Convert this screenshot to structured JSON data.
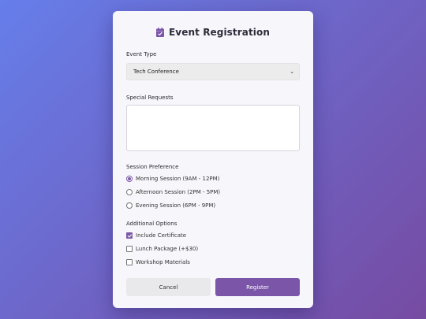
{
  "form": {
    "title": "Event Registration",
    "title_icon": "calendar-check-icon",
    "accent_color": "#7b55a8",
    "event_type": {
      "label": "Event Type",
      "selected": "Tech Conference"
    },
    "special_requests": {
      "label": "Special Requests",
      "value": ""
    },
    "session": {
      "label": "Session Preference",
      "options": [
        {
          "label": "Morning Session (9AM - 12PM)",
          "checked": true
        },
        {
          "label": "Afternoon Session (2PM - 5PM)",
          "checked": false
        },
        {
          "label": "Evening Session (6PM - 9PM)",
          "checked": false
        }
      ]
    },
    "additional": {
      "label": "Additional Options",
      "options": [
        {
          "label": "Include Certificate",
          "checked": true
        },
        {
          "label": "Lunch Package (+$30)",
          "checked": false
        },
        {
          "label": "Workshop Materials",
          "checked": false
        }
      ]
    },
    "buttons": {
      "cancel": "Cancel",
      "register": "Register"
    }
  }
}
